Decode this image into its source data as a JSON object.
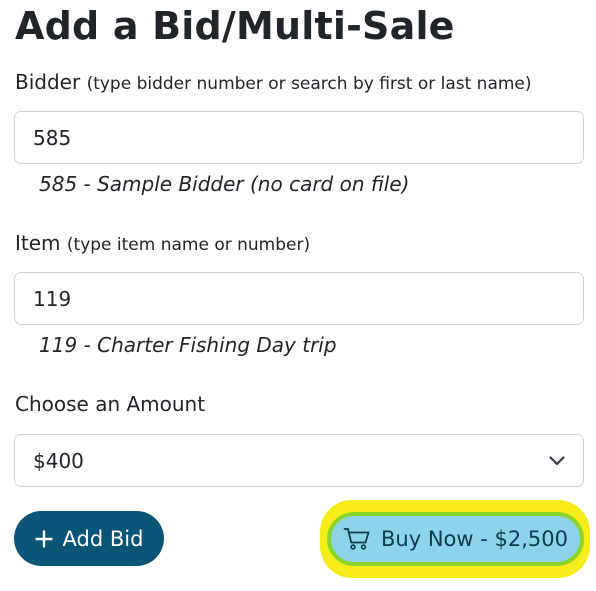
{
  "page": {
    "title": "Add a Bid/Multi-Sale"
  },
  "bidder": {
    "label": "Bidder",
    "hint": "(type bidder number or search by first or last name)",
    "value": "585",
    "match": "585 - Sample Bidder (no card on file)"
  },
  "item": {
    "label": "Item",
    "hint": "(type item name or number)",
    "value": "119",
    "match": "119 - Charter Fishing Day trip"
  },
  "amount": {
    "label": "Choose an Amount",
    "selected": "$400"
  },
  "actions": {
    "add_bid_label": "Add Bid",
    "buy_now_label": "Buy Now - $2,500"
  },
  "icons": {
    "add": "plus-icon",
    "cart": "cart-icon",
    "dropdown": "chevron-down-icon"
  },
  "colors": {
    "primary": "#0a5575",
    "buy_now_bg": "#8fd3ea",
    "highlight": "#f6ec1a",
    "highlight_outline": "#8bd52a"
  }
}
